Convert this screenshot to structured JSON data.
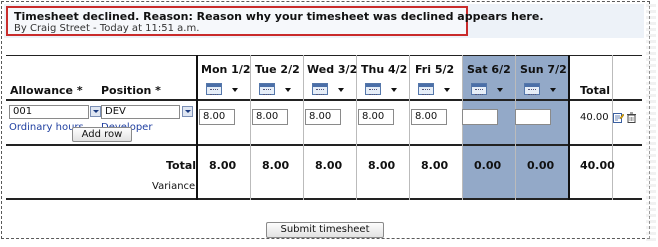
{
  "notice": {
    "title": "Timesheet declined. Reason: Reason why your timesheet was declined appears here.",
    "subtitle": "By Craig Street - Today at 11:51 a.m."
  },
  "table": {
    "headers": {
      "allowance": "Allowance *",
      "position": "Position *",
      "total": "Total"
    },
    "days": [
      {
        "label": "Mon 1/2",
        "hours": "8.00",
        "total": "8.00",
        "weekend": false
      },
      {
        "label": "Tue 2/2",
        "hours": "8.00",
        "total": "8.00",
        "weekend": false
      },
      {
        "label": "Wed 3/2",
        "hours": "8.00",
        "total": "8.00",
        "weekend": false
      },
      {
        "label": "Thu 4/2",
        "hours": "8.00",
        "total": "8.00",
        "weekend": false
      },
      {
        "label": "Fri 5/2",
        "hours": "8.00",
        "total": "8.00",
        "weekend": false
      },
      {
        "label": "Sat 6/2",
        "hours": "",
        "total": "0.00",
        "weekend": true
      },
      {
        "label": "Sun 7/2",
        "hours": "",
        "total": "0.00",
        "weekend": true
      }
    ],
    "row": {
      "allowance_value": "001",
      "allowance_desc": "Ordinary hours",
      "position_value": "DEV",
      "position_desc": "Developer",
      "row_total": "40.00"
    },
    "add_row_label": "Add row",
    "total_label": "Total",
    "variance_label": "Variance",
    "grand_total": "40.00"
  },
  "submit_label": "Submit timesheet",
  "colors": {
    "accent": "#1f3fa0",
    "declined_border": "#c92b2b",
    "weekend_bg": "#93a9c8"
  }
}
